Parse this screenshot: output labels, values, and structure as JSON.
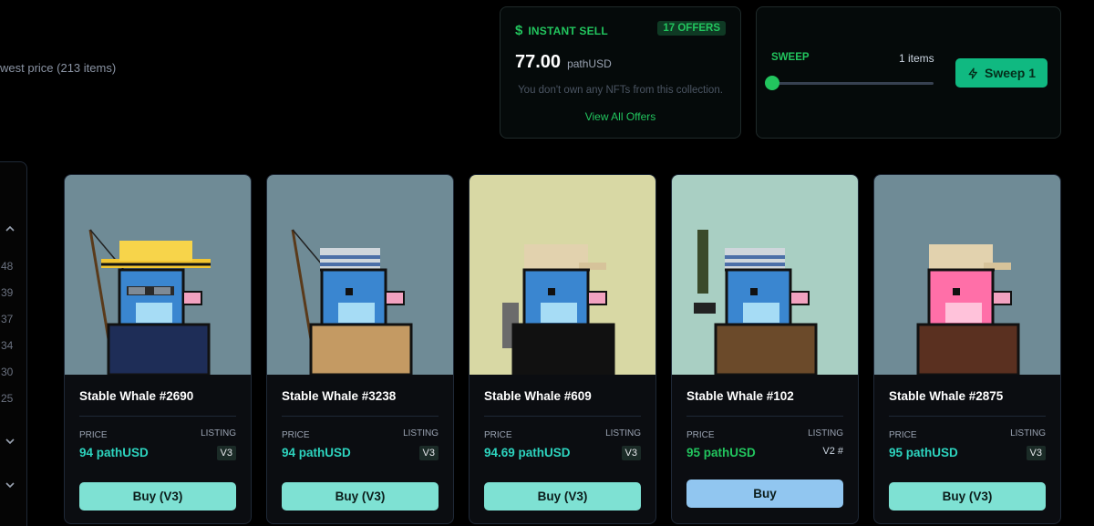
{
  "collection": {
    "subtitle": "west price (213 items)"
  },
  "instant_sell": {
    "symbol": "$",
    "title": "INSTANT SELL",
    "offers_badge": "17 OFFERS",
    "amount": "77.00",
    "unit": "pathUSD",
    "note": "You don't own any NFTs from this collection.",
    "link": "View All Offers"
  },
  "sweep": {
    "label": "SWEEP",
    "count_text": "1 items",
    "slider_value": 1,
    "button_label": "Sweep 1"
  },
  "sidebar": {
    "numbers": [
      "48",
      "39",
      "37",
      "34",
      "30",
      "25"
    ]
  },
  "labels": {
    "price": "PRICE",
    "listing": "LISTING"
  },
  "cards": [
    {
      "name": "Stable Whale #2690",
      "price": "94 pathUSD",
      "version": "V3",
      "buy_label": "Buy (V3)",
      "bg": "#6f8b96"
    },
    {
      "name": "Stable Whale #3238",
      "price": "94 pathUSD",
      "version": "V3",
      "buy_label": "Buy (V3)",
      "bg": "#6f8b96"
    },
    {
      "name": "Stable Whale #609",
      "price": "94.69 pathUSD",
      "version": "V3",
      "buy_label": "Buy (V3)",
      "bg": "#d8d8a4"
    },
    {
      "name": "Stable Whale #102",
      "price": "95 pathUSD",
      "version": "V2 #",
      "buy_label": "Buy",
      "bg": "#a9cfc3"
    },
    {
      "name": "Stable Whale #2875",
      "price": "95 pathUSD",
      "version": "V3",
      "buy_label": "Buy (V3)",
      "bg": "#6f8b96"
    }
  ],
  "colors": {
    "accent_green": "#22c55e",
    "price_teal": "#2dd4bf",
    "buy_teal": "#7ee1d3",
    "buy_blue": "#91c6f0"
  }
}
